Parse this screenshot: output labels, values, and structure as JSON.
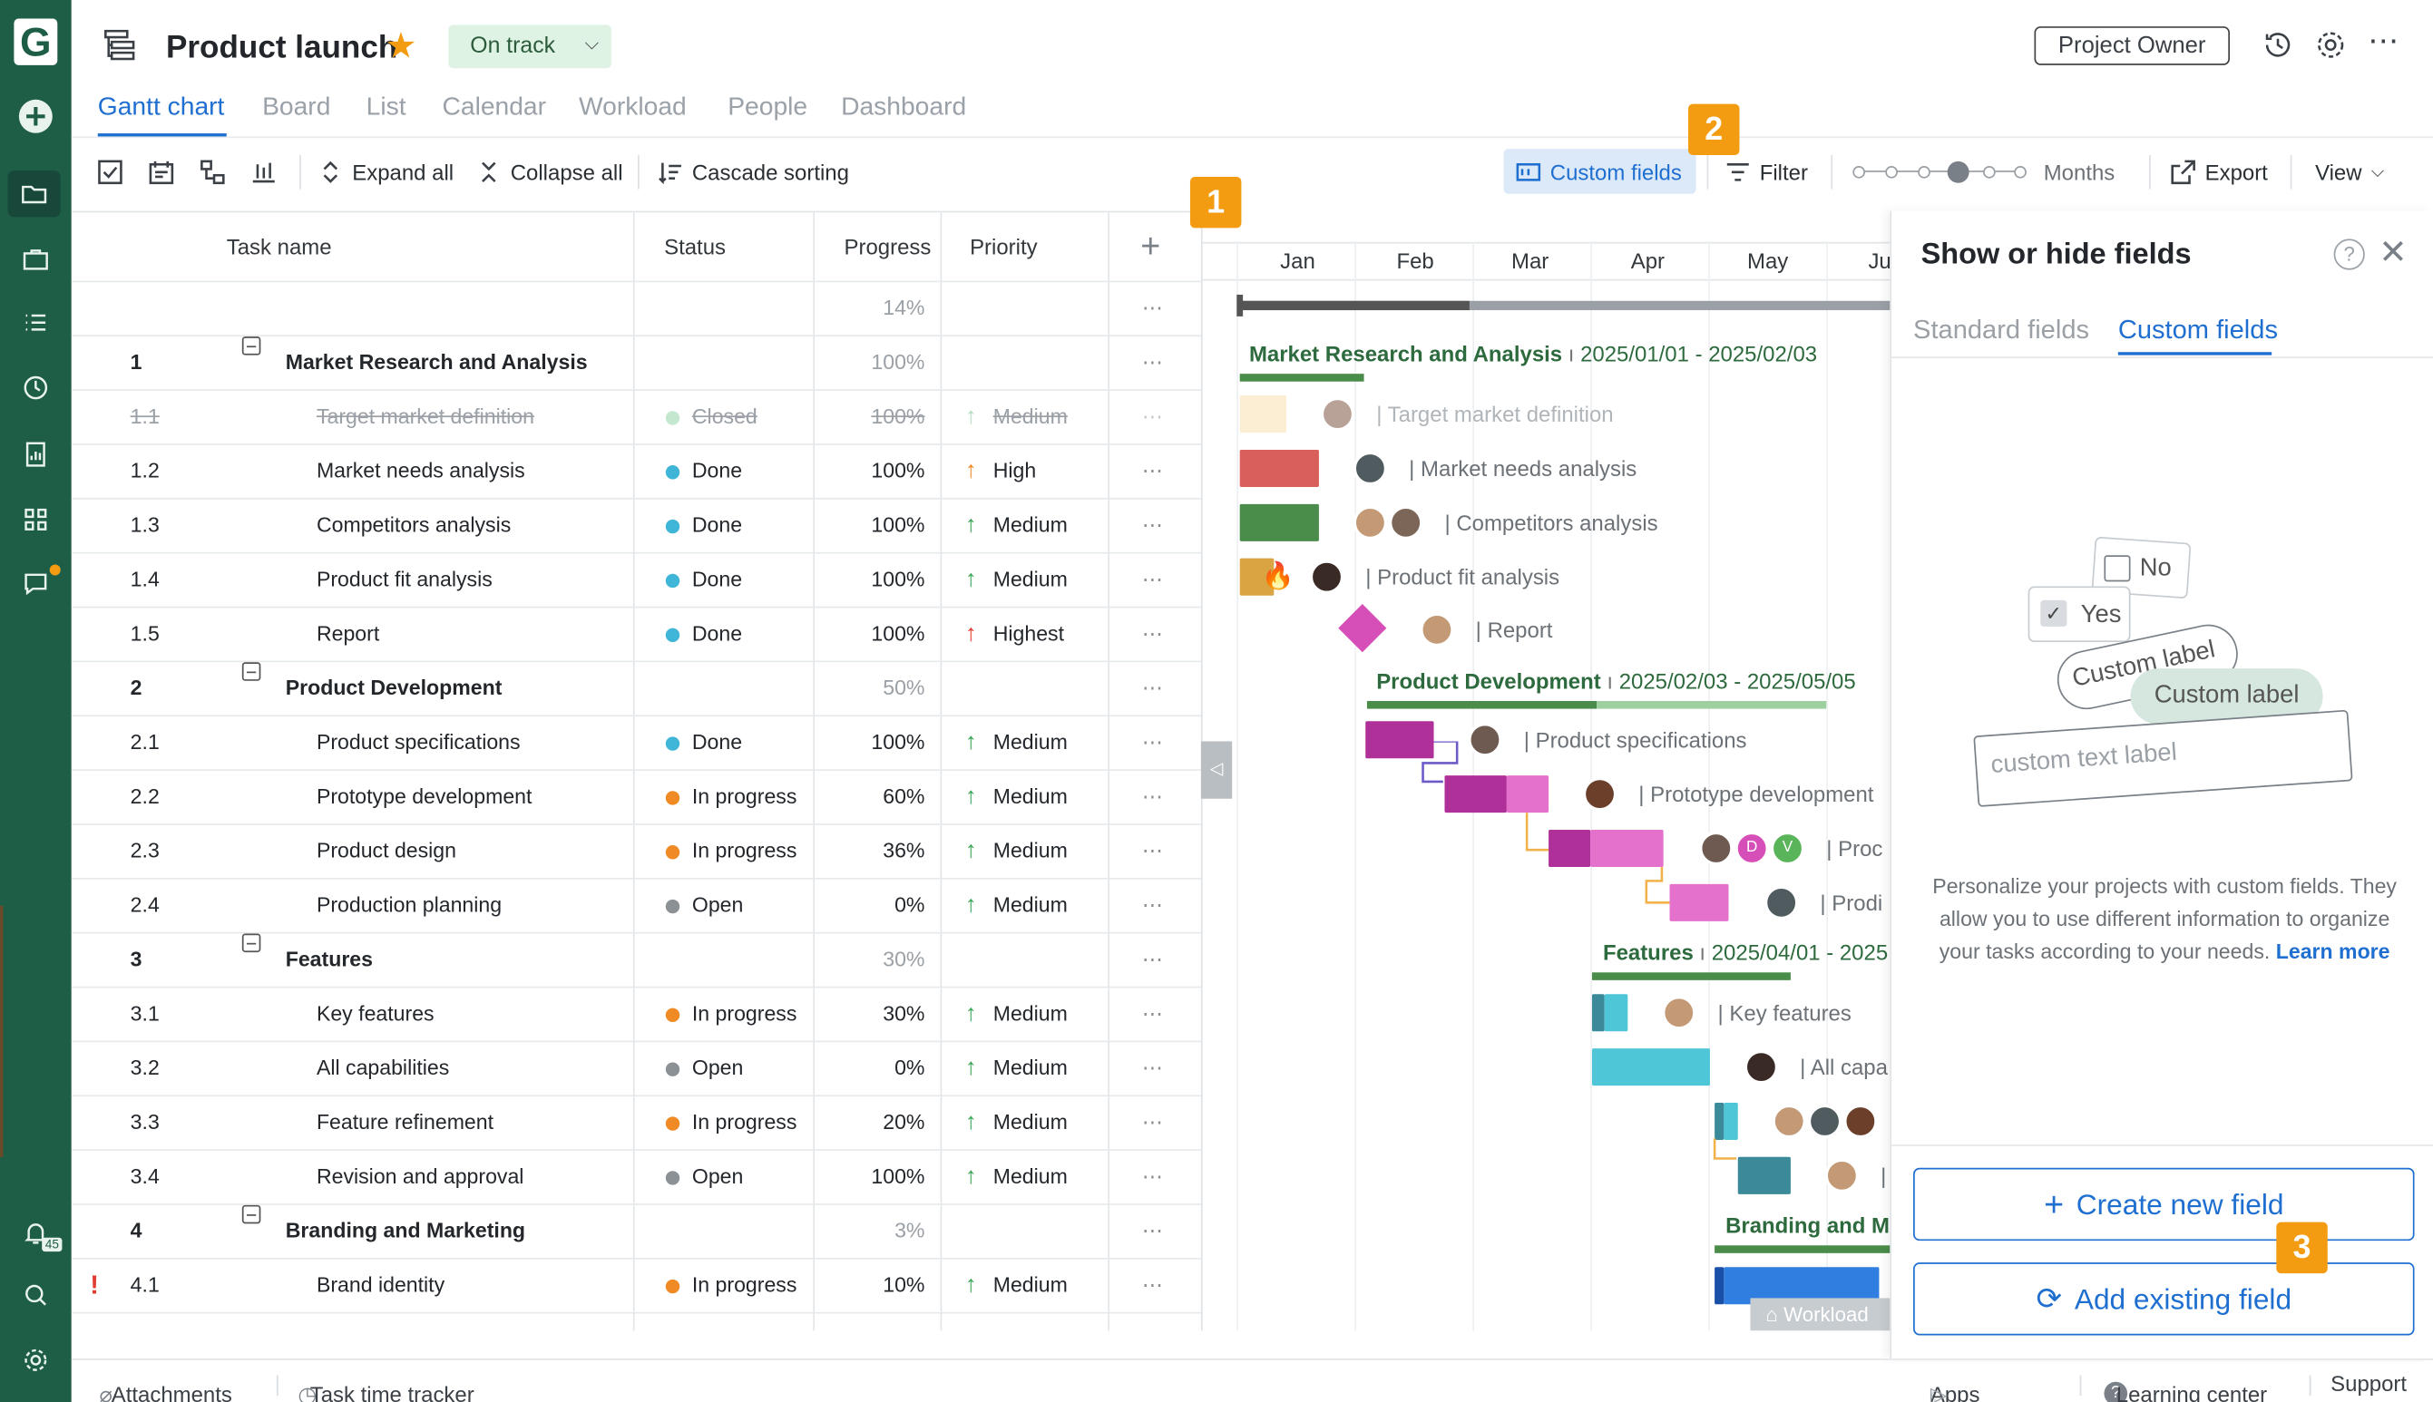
{
  "app": {
    "logo": "G"
  },
  "rail": {
    "icons": [
      "plus-circle-icon",
      "folder-icon",
      "briefcase-icon",
      "list-icon",
      "clock-icon",
      "report-icon",
      "grid-icon",
      "chat-icon"
    ],
    "notifications_count": "45"
  },
  "header": {
    "title": "Product launch",
    "status": "On track",
    "owner_button": "Project Owner",
    "status_color": "#dff3e4"
  },
  "tabs": [
    "Gantt chart",
    "Board",
    "List",
    "Calendar",
    "Workload",
    "People",
    "Dashboard"
  ],
  "toolbar": {
    "expand_all": "Expand all",
    "collapse_all": "Collapse all",
    "cascade_sorting": "Cascade sorting",
    "custom_fields": "Custom fields",
    "filter": "Filter",
    "zoom_unit": "Months",
    "export": "Export",
    "view": "View"
  },
  "grid": {
    "headers": {
      "task_name": "Task name",
      "status": "Status",
      "progress": "Progress",
      "priority": "Priority"
    },
    "total_progress": "14%",
    "rows": [
      {
        "num": "1",
        "name": "Market Research and Analysis",
        "status": "",
        "progress": "100%",
        "priority": "",
        "group": true
      },
      {
        "num": "1.1",
        "name": "Target market definition",
        "status": "Closed",
        "progress": "100%",
        "priority": "Medium",
        "muted": true
      },
      {
        "num": "1.2",
        "name": "Market needs analysis",
        "status": "Done",
        "progress": "100%",
        "priority": "High"
      },
      {
        "num": "1.3",
        "name": "Competitors analysis",
        "status": "Done",
        "progress": "100%",
        "priority": "Medium"
      },
      {
        "num": "1.4",
        "name": "Product fit analysis",
        "status": "Done",
        "progress": "100%",
        "priority": "Medium"
      },
      {
        "num": "1.5",
        "name": "Report",
        "status": "Done",
        "progress": "100%",
        "priority": "Highest"
      },
      {
        "num": "2",
        "name": "Product Development",
        "status": "",
        "progress": "50%",
        "priority": "",
        "group": true
      },
      {
        "num": "2.1",
        "name": "Product specifications",
        "status": "Done",
        "progress": "100%",
        "priority": "Medium"
      },
      {
        "num": "2.2",
        "name": "Prototype development",
        "status": "In progress",
        "progress": "60%",
        "priority": "Medium"
      },
      {
        "num": "2.3",
        "name": "Product design",
        "status": "In progress",
        "progress": "36%",
        "priority": "Medium"
      },
      {
        "num": "2.4",
        "name": "Production planning",
        "status": "Open",
        "progress": "0%",
        "priority": "Medium"
      },
      {
        "num": "3",
        "name": "Features",
        "status": "",
        "progress": "30%",
        "priority": "",
        "group": true
      },
      {
        "num": "3.1",
        "name": "Key features",
        "status": "In progress",
        "progress": "30%",
        "priority": "Medium"
      },
      {
        "num": "3.2",
        "name": "All capabilities",
        "status": "Open",
        "progress": "0%",
        "priority": "Medium"
      },
      {
        "num": "3.3",
        "name": "Feature refinement",
        "status": "In progress",
        "progress": "20%",
        "priority": "Medium"
      },
      {
        "num": "3.4",
        "name": "Revision and approval",
        "status": "Open",
        "progress": "100%",
        "priority": "Medium"
      },
      {
        "num": "4",
        "name": "Branding and Marketing",
        "status": "",
        "progress": "3%",
        "priority": "",
        "group": true
      },
      {
        "num": "4.1",
        "name": "Brand identity",
        "status": "In progress",
        "progress": "10%",
        "priority": "Medium",
        "flag": "!"
      }
    ]
  },
  "gantt": {
    "months": [
      "Jan",
      "Feb",
      "Mar",
      "Apr",
      "May",
      "Ju"
    ],
    "groups": [
      {
        "name": "Market Research and Analysis",
        "dates": "2025/01/01 - 2025/02/03"
      },
      {
        "name": "Product Development",
        "dates": "2025/02/03 - 2025/05/05"
      },
      {
        "name": "Features",
        "dates": "2025/04/01 - 2025"
      },
      {
        "name": "Branding and Ma"
      }
    ],
    "task_labels": [
      "Target market definition",
      "Market needs analysis",
      "Competitors analysis",
      "Product fit analysis",
      "Report",
      "Product specifications",
      "Prototype development",
      "Proc",
      "Prodi",
      "Key features",
      "All capa"
    ],
    "avatar_initials": [
      "D",
      "V"
    ],
    "workload_tab": "Workload"
  },
  "callouts": [
    "1",
    "2",
    "3"
  ],
  "panel": {
    "title": "Show or hide fields",
    "tabs": [
      "Standard fields",
      "Custom fields"
    ],
    "illustration": {
      "no": "No",
      "yes": "Yes",
      "label1": "Custom label",
      "label2": "Custom label",
      "text": "custom text label"
    },
    "description": "Personalize your projects with custom fields. They allow you to use different information to organize your tasks according to your needs.",
    "learn_more": "Learn more",
    "create_button": "Create new field",
    "add_button": "Add existing field"
  },
  "footer": {
    "attachments": "Attachments",
    "time_tracker": "Task time tracker",
    "apps": "Apps",
    "learning": "Learning center",
    "support": "Support"
  }
}
